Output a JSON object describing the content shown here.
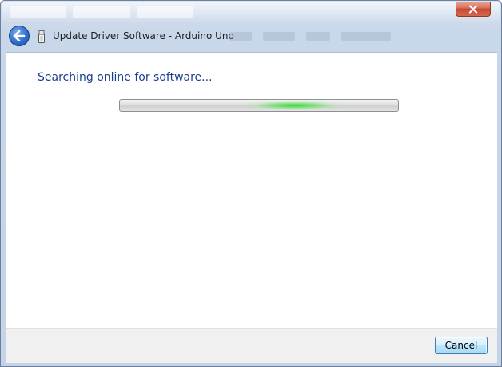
{
  "window": {
    "close_icon": "close-icon"
  },
  "header": {
    "back_icon": "back-arrow-icon",
    "device_icon": "usb-device-icon",
    "title": "Update Driver Software - Arduino Uno"
  },
  "main": {
    "heading": "Searching online for software...",
    "progress": {
      "mode": "indeterminate",
      "glow_color": "#30dc30"
    }
  },
  "footer": {
    "cancel_label": "Cancel"
  },
  "colors": {
    "heading": "#1c3f8c",
    "close_button": "#c74a33",
    "back_button": "#2f6fd0"
  }
}
